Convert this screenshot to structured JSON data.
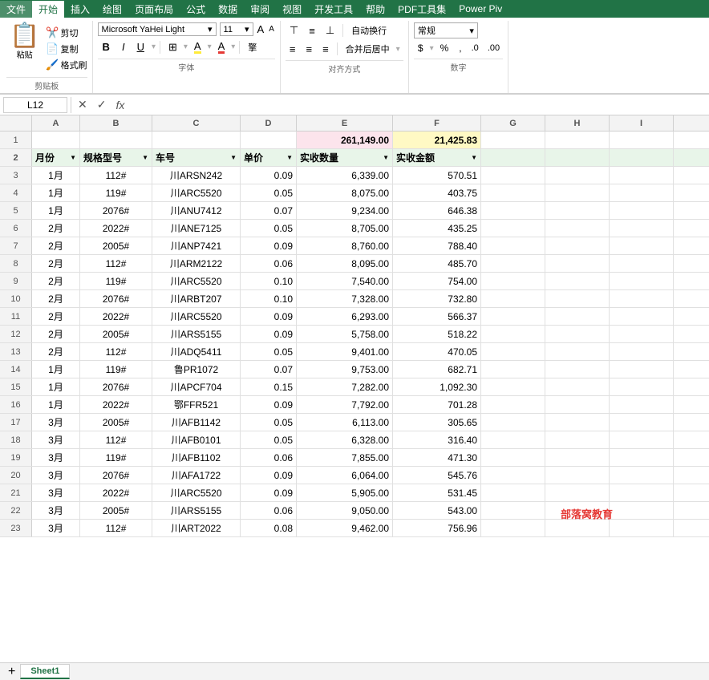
{
  "menubar": {
    "items": [
      "文件",
      "开始",
      "插入",
      "绘图",
      "页面布局",
      "公式",
      "数据",
      "审阅",
      "视图",
      "开发工具",
      "帮助",
      "PDF工具集",
      "Power Piv"
    ],
    "active": "开始"
  },
  "ribbon": {
    "font_name": "Microsoft YaHei Light",
    "font_size": "11",
    "wrap_text": "自动换行",
    "merge_label": "合并后居中",
    "format_label": "常规",
    "groups": [
      "剪贴板",
      "字体",
      "对齐方式",
      "数字"
    ],
    "clipboard": {
      "paste": "粘贴",
      "cut": "剪切",
      "copy": "复制",
      "format": "格式刷"
    }
  },
  "formula_bar": {
    "cell_ref": "L12",
    "formula": ""
  },
  "columns": {
    "letters": [
      "A",
      "B",
      "C",
      "D",
      "E",
      "F",
      "G",
      "H",
      "I"
    ],
    "widths": [
      60,
      90,
      110,
      70,
      120,
      110,
      80,
      80,
      80
    ]
  },
  "row1": {
    "e_value": "261,149.00",
    "f_value": "21,425.83"
  },
  "header_row": {
    "a": "月份",
    "b": "规格型号",
    "c": "车号",
    "d": "单价",
    "e": "实收数量",
    "f": "实收金额"
  },
  "rows": [
    {
      "num": 3,
      "a": "1月",
      "b": "112#",
      "c": "川ARSN242",
      "d": "0.09",
      "e": "6,339.00",
      "f": "570.51"
    },
    {
      "num": 4,
      "a": "1月",
      "b": "119#",
      "c": "川ARC5520",
      "d": "0.05",
      "e": "8,075.00",
      "f": "403.75"
    },
    {
      "num": 5,
      "a": "1月",
      "b": "2076#",
      "c": "川ANU7412",
      "d": "0.07",
      "e": "9,234.00",
      "f": "646.38"
    },
    {
      "num": 6,
      "a": "2月",
      "b": "2022#",
      "c": "川ANE7125",
      "d": "0.05",
      "e": "8,705.00",
      "f": "435.25"
    },
    {
      "num": 7,
      "a": "2月",
      "b": "2005#",
      "c": "川ANP7421",
      "d": "0.09",
      "e": "8,760.00",
      "f": "788.40"
    },
    {
      "num": 8,
      "a": "2月",
      "b": "112#",
      "c": "川ARM2122",
      "d": "0.06",
      "e": "8,095.00",
      "f": "485.70"
    },
    {
      "num": 9,
      "a": "2月",
      "b": "119#",
      "c": "川ARC5520",
      "d": "0.10",
      "e": "7,540.00",
      "f": "754.00"
    },
    {
      "num": 10,
      "a": "2月",
      "b": "2076#",
      "c": "川ARBT207",
      "d": "0.10",
      "e": "7,328.00",
      "f": "732.80"
    },
    {
      "num": 11,
      "a": "2月",
      "b": "2022#",
      "c": "川ARC5520",
      "d": "0.09",
      "e": "6,293.00",
      "f": "566.37"
    },
    {
      "num": 12,
      "a": "2月",
      "b": "2005#",
      "c": "川ARS5155",
      "d": "0.09",
      "e": "5,758.00",
      "f": "518.22"
    },
    {
      "num": 13,
      "a": "2月",
      "b": "112#",
      "c": "川ADQ5411",
      "d": "0.05",
      "e": "9,401.00",
      "f": "470.05"
    },
    {
      "num": 14,
      "a": "1月",
      "b": "119#",
      "c": "鲁PR1072",
      "d": "0.07",
      "e": "9,753.00",
      "f": "682.71"
    },
    {
      "num": 15,
      "a": "1月",
      "b": "2076#",
      "c": "川APCF704",
      "d": "0.15",
      "e": "7,282.00",
      "f": "1,092.30"
    },
    {
      "num": 16,
      "a": "1月",
      "b": "2022#",
      "c": "鄂FFR521",
      "d": "0.09",
      "e": "7,792.00",
      "f": "701.28"
    },
    {
      "num": 17,
      "a": "3月",
      "b": "2005#",
      "c": "川AFB1142",
      "d": "0.05",
      "e": "6,113.00",
      "f": "305.65"
    },
    {
      "num": 18,
      "a": "3月",
      "b": "112#",
      "c": "川AFB0101",
      "d": "0.05",
      "e": "6,328.00",
      "f": "316.40"
    },
    {
      "num": 19,
      "a": "3月",
      "b": "119#",
      "c": "川AFB1102",
      "d": "0.06",
      "e": "7,855.00",
      "f": "471.30"
    },
    {
      "num": 20,
      "a": "3月",
      "b": "2076#",
      "c": "川AFA1722",
      "d": "0.09",
      "e": "6,064.00",
      "f": "545.76"
    },
    {
      "num": 21,
      "a": "3月",
      "b": "2022#",
      "c": "川ARC5520",
      "d": "0.09",
      "e": "5,905.00",
      "f": "531.45"
    },
    {
      "num": 22,
      "a": "3月",
      "b": "2005#",
      "c": "川ARS5155",
      "d": "0.06",
      "e": "9,050.00",
      "f": "543.00"
    },
    {
      "num": 23,
      "a": "3月",
      "b": "112#",
      "c": "川ART2022",
      "d": "0.08",
      "e": "9,462.00",
      "f": "756.96"
    }
  ],
  "watermark": "部落窝教育",
  "sheet_tabs": [
    "Sheet1"
  ],
  "active_sheet": "Sheet1"
}
